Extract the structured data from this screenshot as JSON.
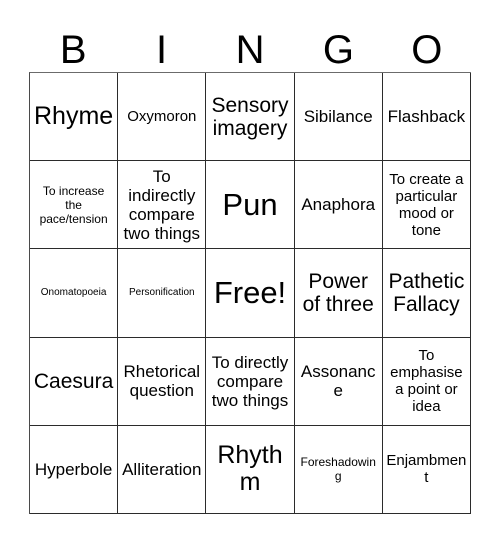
{
  "card": {
    "type": "bingo-card",
    "topic": "Poetry / Literary Techniques",
    "columns": 5,
    "rows": 5,
    "background_color": "#ffffff",
    "border_color": "#2b2b2b",
    "text_color": "#000000"
  },
  "header": {
    "letters": [
      "B",
      "I",
      "N",
      "G",
      "O"
    ]
  },
  "grid": {
    "rows": [
      {
        "cells": [
          {
            "text": "Rhyme",
            "size": "xl",
            "free": false
          },
          {
            "text": "Oxymoron",
            "size": "sm",
            "free": false
          },
          {
            "text": "Sensory imagery",
            "size": "lg",
            "free": false
          },
          {
            "text": "Sibilance",
            "size": "md",
            "free": false
          },
          {
            "text": "Flashback",
            "size": "md",
            "free": false
          }
        ]
      },
      {
        "cells": [
          {
            "text": "To increase the pace/tension",
            "size": "xs",
            "free": false
          },
          {
            "text": "To indirectly compare two things",
            "size": "md",
            "free": false
          },
          {
            "text": "Pun",
            "size": "xxl",
            "free": false
          },
          {
            "text": "Anaphora",
            "size": "md",
            "free": false
          },
          {
            "text": "To create a particular mood or tone",
            "size": "sm",
            "free": false
          }
        ]
      },
      {
        "cells": [
          {
            "text": "Onomatopoeia",
            "size": "xxs",
            "free": false
          },
          {
            "text": "Personification",
            "size": "xxs",
            "free": false
          },
          {
            "text": "Free!",
            "size": "xxl",
            "free": true
          },
          {
            "text": "Power of three",
            "size": "lg",
            "free": false
          },
          {
            "text": "Pathetic Fallacy",
            "size": "lg",
            "free": false
          }
        ]
      },
      {
        "cells": [
          {
            "text": "Caesura",
            "size": "lg",
            "free": false
          },
          {
            "text": "Rhetorical question",
            "size": "md",
            "free": false
          },
          {
            "text": "To directly compare two things",
            "size": "md",
            "free": false
          },
          {
            "text": "Assonance",
            "size": "md",
            "free": false
          },
          {
            "text": "To emphasise a point or idea",
            "size": "sm",
            "free": false
          }
        ]
      },
      {
        "cells": [
          {
            "text": "Hyperbole",
            "size": "md",
            "free": false
          },
          {
            "text": "Alliteration",
            "size": "md",
            "free": false
          },
          {
            "text": "Rhythm",
            "size": "xl",
            "free": false
          },
          {
            "text": "Foreshadowing",
            "size": "xs",
            "free": false
          },
          {
            "text": "Enjambment",
            "size": "sm",
            "free": false
          }
        ]
      }
    ]
  }
}
